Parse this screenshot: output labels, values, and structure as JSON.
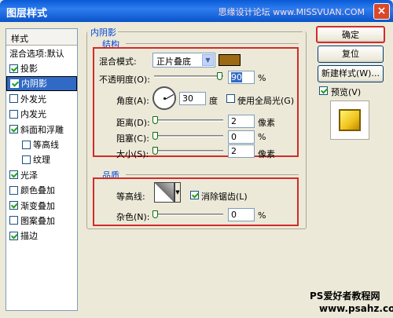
{
  "window": {
    "title": "图层样式",
    "watermark": "思缘设计论坛 www.MISSVUAN.COM",
    "close_icon": "×"
  },
  "sidebar": {
    "header": "样式",
    "items": [
      {
        "label": "混合选项:默认",
        "checkbox": false,
        "checked": false,
        "indent": false,
        "selected": false
      },
      {
        "label": "投影",
        "checkbox": true,
        "checked": true,
        "indent": false,
        "selected": false
      },
      {
        "label": "内阴影",
        "checkbox": true,
        "checked": true,
        "indent": false,
        "selected": true
      },
      {
        "label": "外发光",
        "checkbox": true,
        "checked": false,
        "indent": false,
        "selected": false
      },
      {
        "label": "内发光",
        "checkbox": true,
        "checked": false,
        "indent": false,
        "selected": false
      },
      {
        "label": "斜面和浮雕",
        "checkbox": true,
        "checked": true,
        "indent": false,
        "selected": false
      },
      {
        "label": "等高线",
        "checkbox": true,
        "checked": false,
        "indent": true,
        "selected": false
      },
      {
        "label": "纹理",
        "checkbox": true,
        "checked": false,
        "indent": true,
        "selected": false
      },
      {
        "label": "光泽",
        "checkbox": true,
        "checked": true,
        "indent": false,
        "selected": false
      },
      {
        "label": "颜色叠加",
        "checkbox": true,
        "checked": false,
        "indent": false,
        "selected": false
      },
      {
        "label": "渐变叠加",
        "checkbox": true,
        "checked": true,
        "indent": false,
        "selected": false
      },
      {
        "label": "图案叠加",
        "checkbox": true,
        "checked": false,
        "indent": false,
        "selected": false
      },
      {
        "label": "描边",
        "checkbox": true,
        "checked": true,
        "indent": false,
        "selected": false
      }
    ]
  },
  "inner_shadow": {
    "section_title": "内阴影",
    "structure": {
      "title": "结构",
      "blend_mode_label": "混合模式:",
      "blend_mode_value": "正片叠底",
      "color": "#9c6a12",
      "opacity_label": "不透明度(O):",
      "opacity_value": "90",
      "opacity_unit": "%",
      "angle_label": "角度(A):",
      "angle_value": "30",
      "angle_unit": "度",
      "global_light_label": "使用全局光(G)",
      "global_light_checked": false,
      "distance_label": "距离(D):",
      "distance_value": "2",
      "distance_unit": "像素",
      "choke_label": "阻塞(C):",
      "choke_value": "0",
      "choke_unit": "%",
      "size_label": "大小(S):",
      "size_value": "2",
      "size_unit": "像素"
    },
    "quality": {
      "title": "品质",
      "contour_label": "等高线:",
      "anti_alias_label": "消除锯齿(L)",
      "anti_alias_checked": true,
      "noise_label": "杂色(N):",
      "noise_value": "0",
      "noise_unit": "%"
    }
  },
  "buttons": {
    "ok": "确定",
    "reset": "复位",
    "new_style": "新建样式(W)...",
    "preview_label": "预览(V)",
    "preview_checked": true
  },
  "footer": {
    "brand": "PS爱好者教程网",
    "url": "www.psahz.com"
  },
  "colors": {
    "title_bar": "#0a5bd6",
    "selection": "#316ac5",
    "highlight_box": "#d32b2b",
    "section_title": "#0046d5"
  }
}
